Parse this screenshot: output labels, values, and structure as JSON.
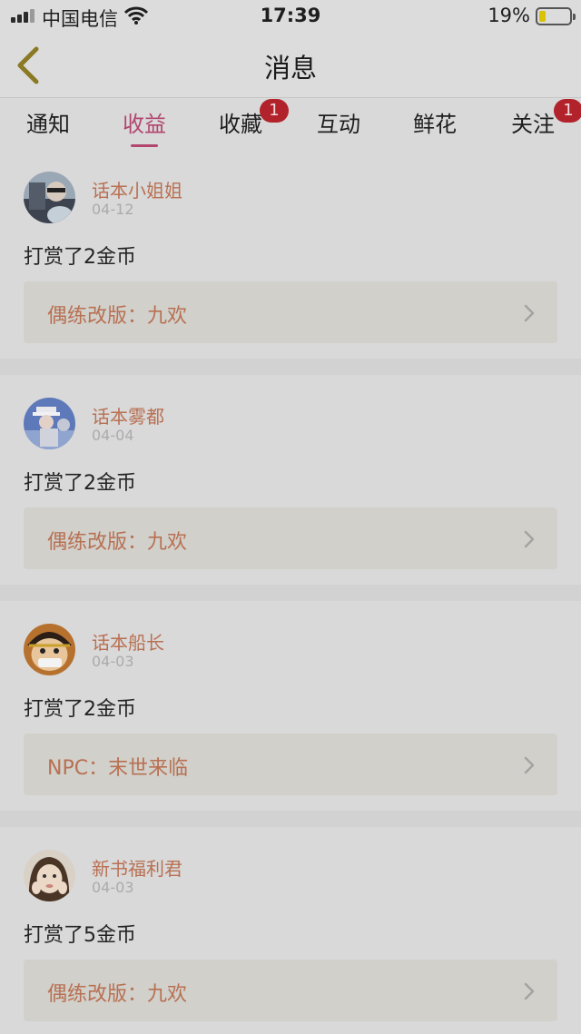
{
  "status_bar": {
    "carrier": "中国电信",
    "time": "17:39",
    "battery": "19%"
  },
  "header": {
    "title": "消息"
  },
  "tabs": [
    {
      "label": "通知"
    },
    {
      "label": "收益",
      "active": true
    },
    {
      "label": "收藏",
      "badge": "1"
    },
    {
      "label": "互动"
    },
    {
      "label": "鲜花"
    },
    {
      "label": "关注",
      "badge": "1"
    }
  ],
  "messages": [
    {
      "sender": "话本小姐姐",
      "date": "04-12",
      "text": "打赏了2金币",
      "work": "偶练改版：九欢"
    },
    {
      "sender": "话本雾都",
      "date": "04-04",
      "text": "打赏了2金币",
      "work": "偶练改版：九欢"
    },
    {
      "sender": "话本船长",
      "date": "04-03",
      "text": "打赏了2金币",
      "work": "NPC：末世来临"
    },
    {
      "sender": "新书福利君",
      "date": "04-03",
      "text": "打赏了5金币",
      "work": "偶练改版：九欢"
    }
  ],
  "colors": {
    "accent": "#b2466e",
    "name": "#b87052",
    "badge": "#b2222b"
  }
}
